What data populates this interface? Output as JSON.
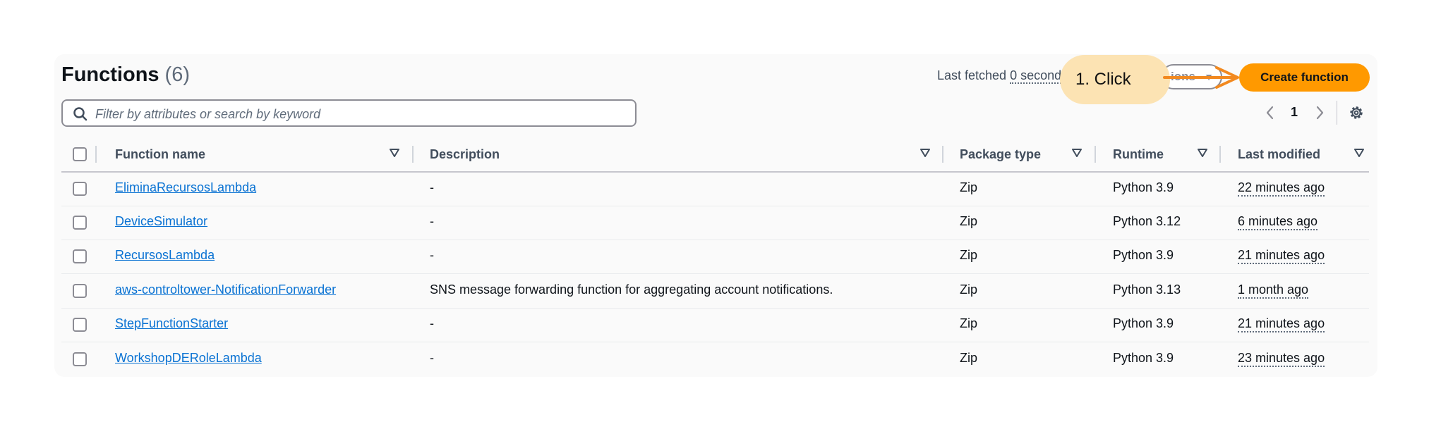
{
  "header": {
    "title": "Functions",
    "count": "(6)",
    "last_fetched_label": "Last fetched",
    "last_fetched_value": "0 second",
    "actions_label": "ions",
    "create_label": "Create function"
  },
  "annotation": {
    "callout_text": "1. Click",
    "color": "#f2891f"
  },
  "search": {
    "placeholder": "Filter by attributes or search by keyword"
  },
  "pagination": {
    "current_page": "1"
  },
  "table": {
    "columns": [
      "Function name",
      "Description",
      "Package type",
      "Runtime",
      "Last modified"
    ],
    "rows": [
      {
        "name": "EliminaRecursosLambda",
        "description": "-",
        "package": "Zip",
        "runtime": "Python 3.9",
        "modified": "22 minutes ago"
      },
      {
        "name": "DeviceSimulator",
        "description": "-",
        "package": "Zip",
        "runtime": "Python 3.12",
        "modified": "6 minutes ago"
      },
      {
        "name": "RecursosLambda",
        "description": "-",
        "package": "Zip",
        "runtime": "Python 3.9",
        "modified": "21 minutes ago"
      },
      {
        "name": "aws-controltower-NotificationForwarder",
        "description": "SNS message forwarding function for aggregating account notifications.",
        "package": "Zip",
        "runtime": "Python 3.13",
        "modified": "1 month ago"
      },
      {
        "name": "StepFunctionStarter",
        "description": "-",
        "package": "Zip",
        "runtime": "Python 3.9",
        "modified": "21 minutes ago"
      },
      {
        "name": "WorkshopDERoleLambda",
        "description": "-",
        "package": "Zip",
        "runtime": "Python 3.9",
        "modified": "23 minutes ago"
      }
    ]
  },
  "colors": {
    "primary_button": "#ff9900",
    "link": "#0972d3",
    "callout_bg": "#fce3b3"
  }
}
